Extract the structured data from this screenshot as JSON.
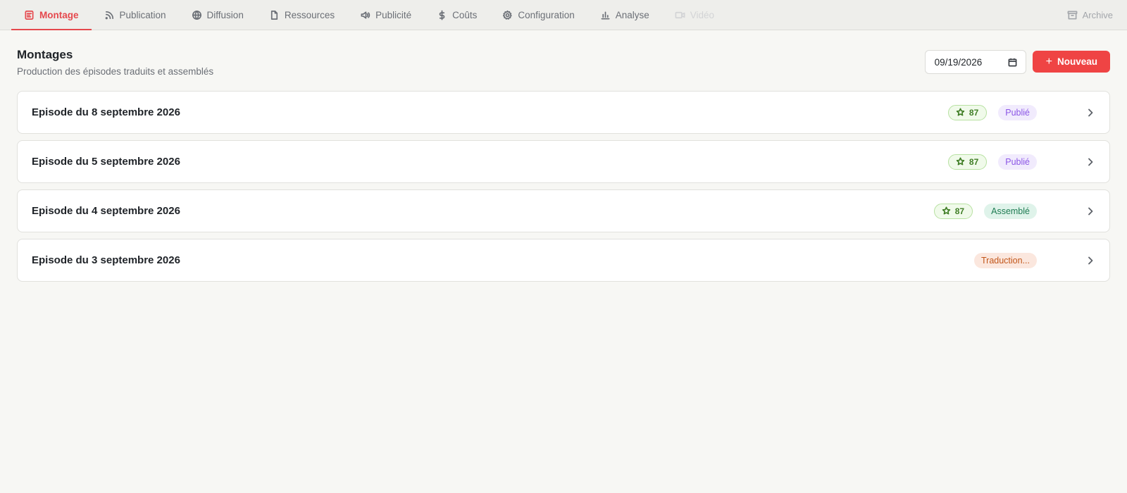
{
  "tabs": [
    {
      "label": "Montage",
      "icon": "document-list-icon",
      "state": "active"
    },
    {
      "label": "Publication",
      "icon": "rss-icon",
      "state": "normal"
    },
    {
      "label": "Diffusion",
      "icon": "globe-icon",
      "state": "normal"
    },
    {
      "label": "Ressources",
      "icon": "file-icon",
      "state": "normal"
    },
    {
      "label": "Publicité",
      "icon": "megaphone-icon",
      "state": "normal"
    },
    {
      "label": "Coûts",
      "icon": "dollar-icon",
      "state": "normal"
    },
    {
      "label": "Configuration",
      "icon": "gear-icon",
      "state": "normal"
    },
    {
      "label": "Analyse",
      "icon": "bar-chart-icon",
      "state": "normal"
    },
    {
      "label": "Vidéo",
      "icon": "video-icon",
      "state": "disabled"
    }
  ],
  "archive_tab": {
    "label": "Archive",
    "icon": "archive-icon"
  },
  "header": {
    "title": "Montages",
    "subtitle": "Production des épisodes traduits et assemblés",
    "date_value": "09/19/2026",
    "new_button_label": "Nouveau"
  },
  "episodes": [
    {
      "title": "Episode du 8 septembre 2026",
      "score": "87",
      "status": "Publié",
      "status_kind": "published"
    },
    {
      "title": "Episode du 5 septembre 2026",
      "score": "87",
      "status": "Publié",
      "status_kind": "published"
    },
    {
      "title": "Episode du 4 septembre 2026",
      "score": "87",
      "status": "Assemblé",
      "status_kind": "assembled"
    },
    {
      "title": "Episode du 3 septembre 2026",
      "score": null,
      "status": "Traduction...",
      "status_kind": "translating"
    }
  ],
  "colors": {
    "accent": "#ef4444",
    "published": "#8b55e6",
    "assembled": "#1e7b52",
    "translating": "#c2571b",
    "score": "#3f7d25"
  }
}
